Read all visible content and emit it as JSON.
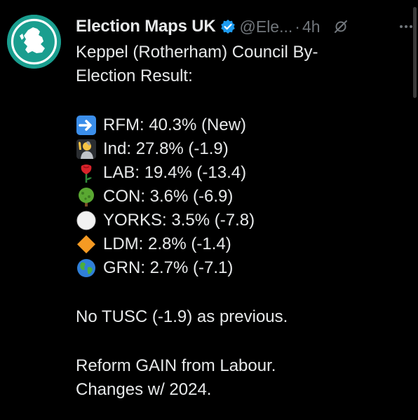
{
  "post": {
    "author_name": "Election Maps UK",
    "handle": "@Ele...",
    "separator": "·",
    "time": "4h",
    "body_lines": [
      "Keppel (Rotherham) Council By-",
      "Election Result:"
    ],
    "results": [
      {
        "label": "RFM: 40.3% (New)",
        "icon": "right-arrow-emoji"
      },
      {
        "label": "Ind: 27.8% (-1.9)",
        "icon": "raised-hand-person-emoji"
      },
      {
        "label": "LAB: 19.4% (-13.4)",
        "icon": "rose-emoji"
      },
      {
        "label": "CON: 3.6% (-6.9)",
        "icon": "tree-emoji"
      },
      {
        "label": "YORKS: 3.5% (-7.8)",
        "icon": "white-circle-emoji"
      },
      {
        "label": "LDM: 2.8% (-1.4)",
        "icon": "orange-diamond-emoji"
      },
      {
        "label": "GRN: 2.7% (-7.1)",
        "icon": "globe-emoji"
      }
    ],
    "note": "No TUSC (-1.9) as previous.",
    "footer_lines": [
      "Reform GAIN from Labour.",
      "Changes w/ 2024."
    ]
  },
  "colors": {
    "background": "#000000",
    "text": "#e7e9ea",
    "muted": "#71767b",
    "verified": "#1d9bf0",
    "avatar": "#1a9e8f"
  }
}
